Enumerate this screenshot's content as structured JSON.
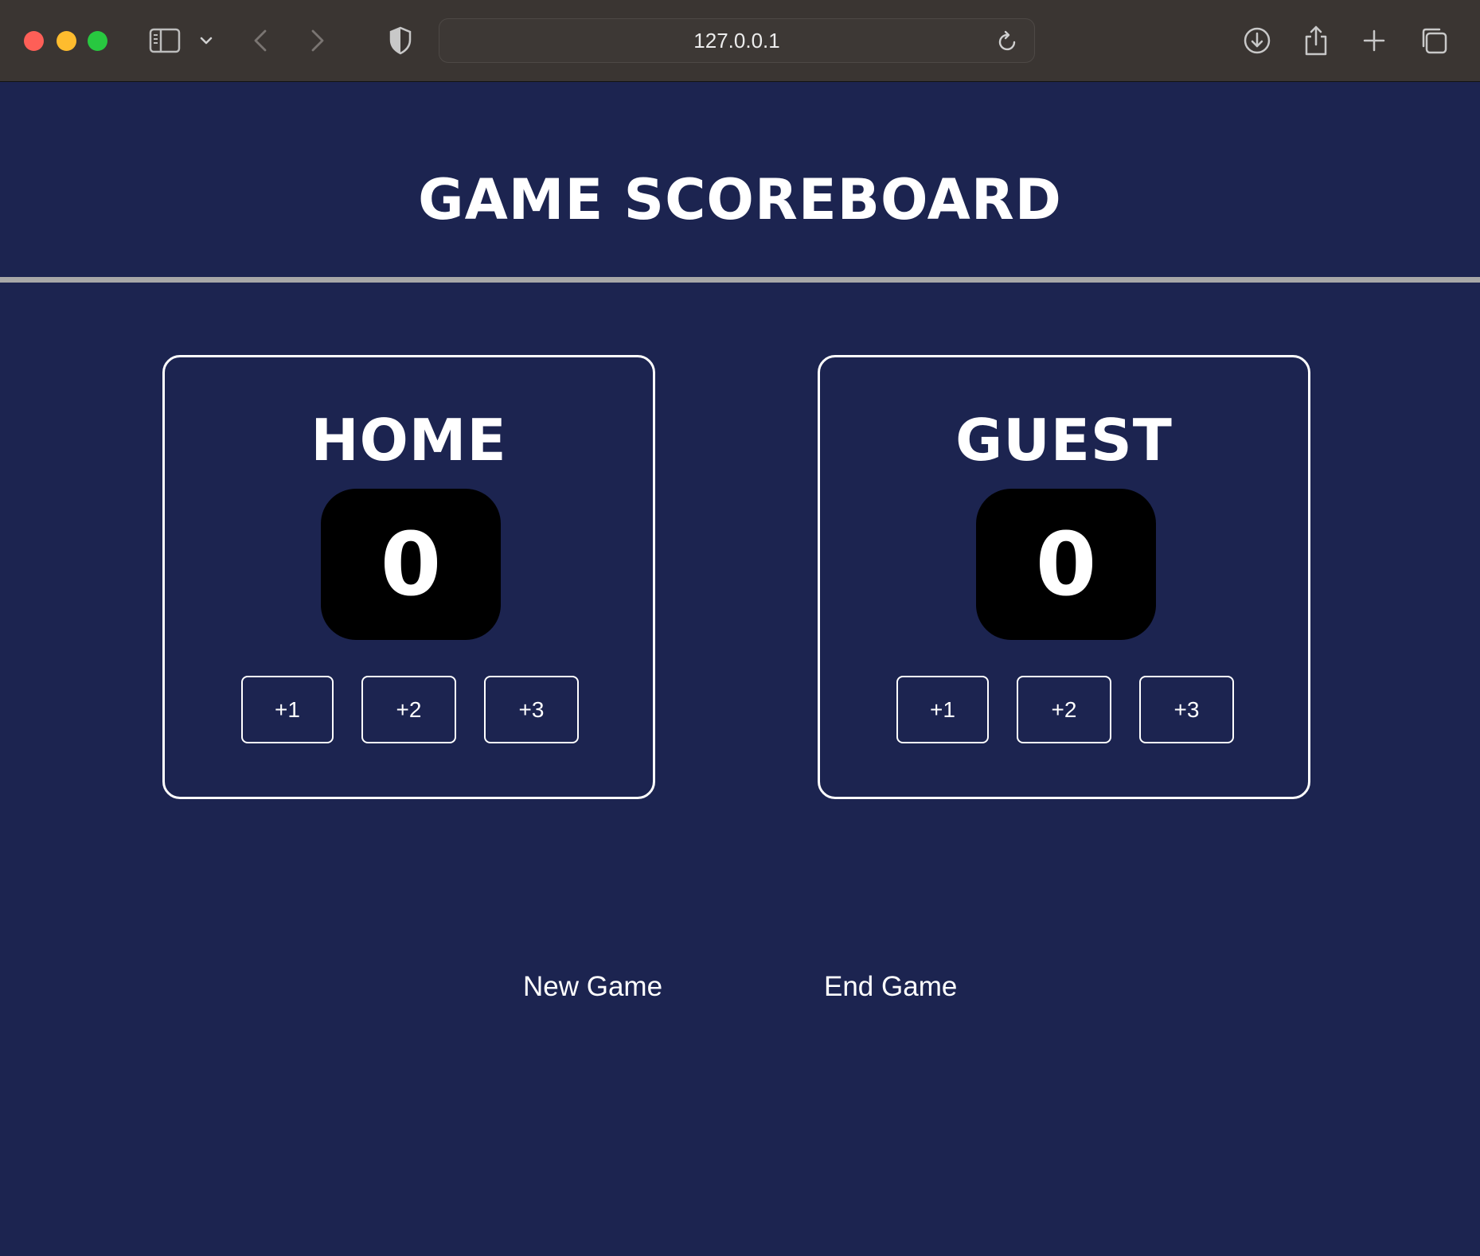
{
  "browser": {
    "url": "127.0.0.1",
    "icons": [
      "sidebar-icon",
      "chevron-down-icon",
      "back-icon",
      "forward-icon",
      "shield-icon",
      "reload-icon",
      "download-icon",
      "share-icon",
      "plus-icon",
      "tabs-icon"
    ]
  },
  "page": {
    "title": "GAME SCOREBOARD"
  },
  "home": {
    "name": "HOME",
    "score": "0",
    "buttons": [
      "+1",
      "+2",
      "+3"
    ]
  },
  "guest": {
    "name": "GUEST",
    "score": "0",
    "buttons": [
      "+1",
      "+2",
      "+3"
    ]
  },
  "controls": {
    "new_game": "New Game",
    "end_game": "End Game"
  },
  "colors": {
    "background": "#1c2450",
    "score_box": "#000000",
    "text": "#ffffff"
  }
}
